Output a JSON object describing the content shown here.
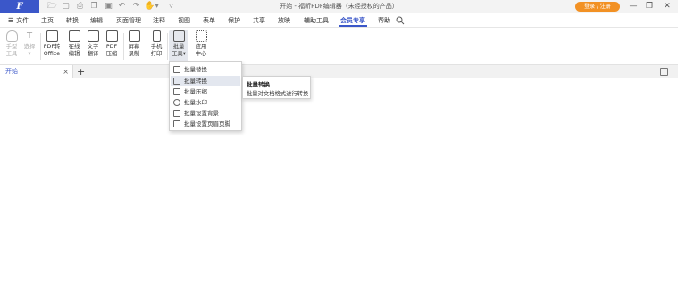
{
  "window": {
    "title": "开始 - 福昕PDF编辑器（未经授权的产品）",
    "login_label": "登录 / 注册",
    "minimize": "—",
    "maximize": "❐",
    "close": "✕"
  },
  "logo": {
    "letter": "F"
  },
  "quick_access": [
    {
      "icon": "open-folder-icon",
      "glyph": "🗁"
    },
    {
      "icon": "new-doc-icon",
      "glyph": "▢"
    },
    {
      "icon": "print-icon",
      "glyph": "⎙"
    },
    {
      "icon": "copy-icon",
      "glyph": "❐"
    },
    {
      "icon": "save-icon",
      "glyph": "▣"
    },
    {
      "icon": "undo-icon",
      "glyph": "↶"
    },
    {
      "icon": "redo-icon",
      "glyph": "↷"
    },
    {
      "icon": "hand-dropdown-icon",
      "glyph": "✋▾"
    },
    {
      "icon": "customize-icon",
      "glyph": "▿"
    }
  ],
  "menu": {
    "file_label": "文件",
    "hamburger": "☰",
    "tabs": [
      "主页",
      "转换",
      "编辑",
      "页面管理",
      "注释",
      "视图",
      "表单",
      "保护",
      "共享",
      "放映",
      "辅助工具",
      "会员专享",
      "帮助"
    ],
    "active_tab": "会员专享",
    "search_icon": "search-icon"
  },
  "ribbon": {
    "buttons": [
      {
        "label1": "手型",
        "label2": "工具",
        "dim": true
      },
      {
        "label1": "选择",
        "label2": "▾",
        "dim": true
      },
      {
        "label1": "PDF转",
        "label2": "Office",
        "dim": false
      },
      {
        "label1": "在线",
        "label2": "编辑",
        "dim": false
      },
      {
        "label1": "文字",
        "label2": "翻译",
        "dim": false
      },
      {
        "label1": "PDF",
        "label2": "压缩",
        "dim": false
      },
      {
        "label1": "屏幕",
        "label2": "录制",
        "dim": false
      },
      {
        "label1": "手机",
        "label2": "打印",
        "dim": false
      },
      {
        "label1": "批量",
        "label2": "工具▾",
        "dim": false
      },
      {
        "label1": "应用",
        "label2": "中心",
        "dim": false
      }
    ]
  },
  "tabs": {
    "doc_tab": "开始",
    "close": "×",
    "add": "+"
  },
  "dropdown": {
    "items": [
      "批量替换",
      "批量转换",
      "批量压缩",
      "批量水印",
      "批量设置背景",
      "批量设置页眉页脚"
    ],
    "hovered": "批量转换"
  },
  "tooltip": {
    "title": "批量转换",
    "desc": "批量对文档格式进行转换"
  }
}
